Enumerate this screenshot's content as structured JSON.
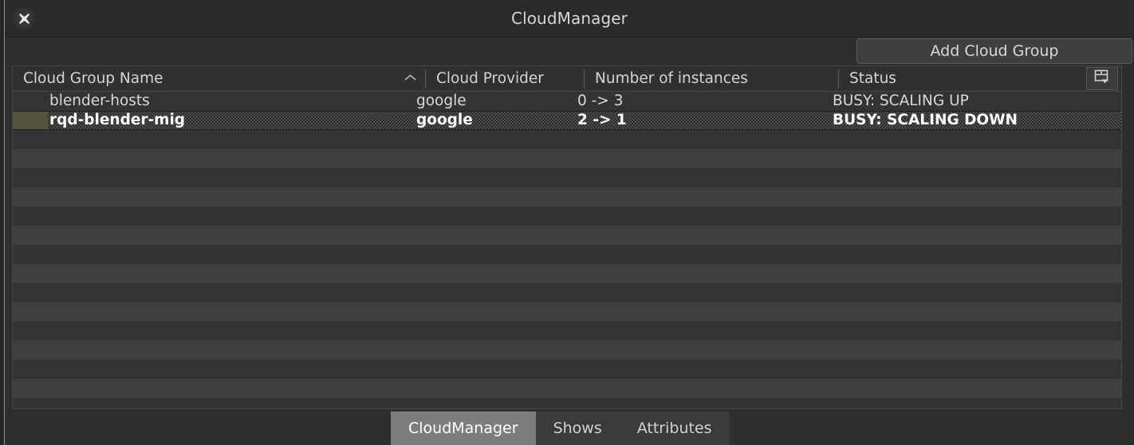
{
  "window": {
    "title": "CloudManager",
    "close_icon": "close-x-icon"
  },
  "toolbar": {
    "add_cloud_group_label": "Add Cloud Group"
  },
  "table": {
    "columns": [
      {
        "label": "Cloud Group Name",
        "sorted": true,
        "sort_icon": "chevron-up-icon"
      },
      {
        "label": "Cloud Provider"
      },
      {
        "label": "Number of instances"
      },
      {
        "label": "Status"
      }
    ],
    "column_config_icon": "table-columns-dropdown-icon",
    "rows": [
      {
        "name": "blender-hosts",
        "provider": "google",
        "instances": "0 -> 3",
        "status": "BUSY: SCALING UP",
        "selected": false
      },
      {
        "name": "rqd-blender-mig",
        "provider": "google",
        "instances": "2 -> 1",
        "status": "BUSY: SCALING DOWN",
        "selected": true,
        "indicator_color": "#55543f"
      }
    ],
    "empty_row_count": 15
  },
  "tabs": [
    {
      "label": "CloudManager",
      "active": true
    },
    {
      "label": "Shows",
      "active": false
    },
    {
      "label": "Attributes",
      "active": false
    }
  ],
  "colors": {
    "window_background": "#2e2e2e",
    "titlebar": "#2a2a2a",
    "table_background": "#333333",
    "row_alt": "#404040",
    "accent_selected_indicator": "#55543f",
    "active_tab": "#7d7d7d",
    "text": "#d8d8d8"
  }
}
